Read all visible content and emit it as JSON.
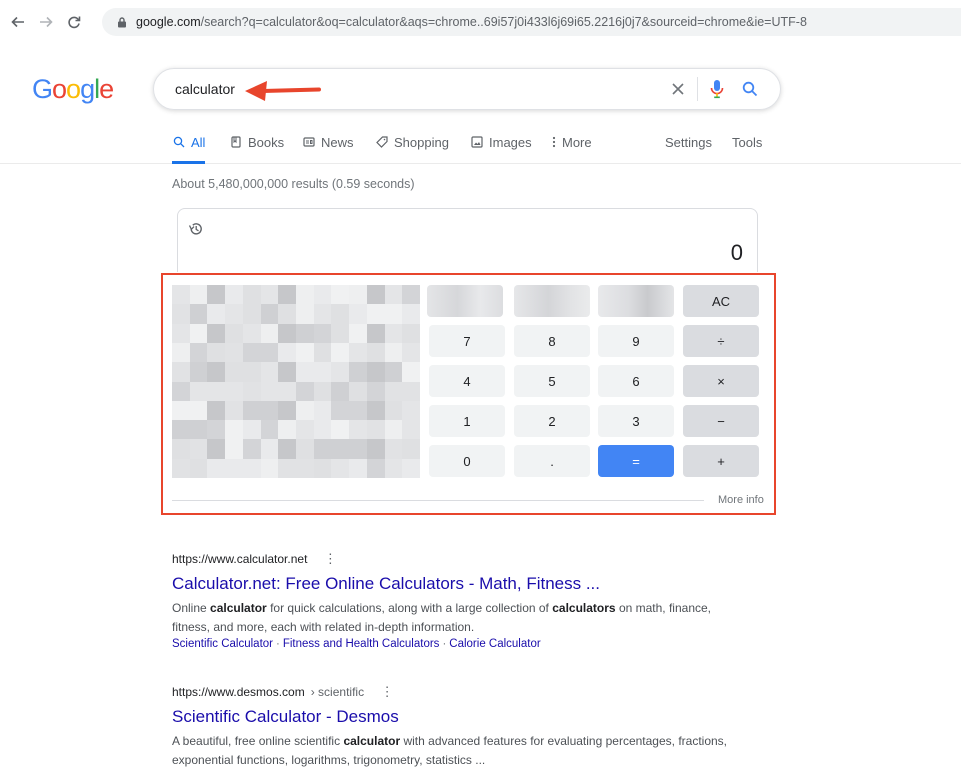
{
  "browser": {
    "url_host": "google.com",
    "url_rest": "/search?q=calculator&oq=calculator&aqs=chrome..69i57j0i433l6j69i65.2216j0j7&sourceid=chrome&ie=UTF-8"
  },
  "logo": {
    "letters": [
      "G",
      "o",
      "o",
      "g",
      "l",
      "e"
    ],
    "colors": [
      "#4285f4",
      "#ea4335",
      "#fbbc05",
      "#4285f4",
      "#34a853",
      "#ea4335"
    ]
  },
  "search": {
    "query": "calculator"
  },
  "tabs": [
    {
      "label": "All",
      "icon": "search-icon",
      "active": true
    },
    {
      "label": "Books",
      "icon": "book-icon"
    },
    {
      "label": "News",
      "icon": "news-icon"
    },
    {
      "label": "Shopping",
      "icon": "tag-icon"
    },
    {
      "label": "Images",
      "icon": "image-icon"
    },
    {
      "label": "More",
      "icon": "more-vert-icon"
    },
    {
      "label": "Settings"
    },
    {
      "label": "Tools"
    }
  ],
  "stats": "About 5,480,000,000 results (0.59 seconds)",
  "calculator": {
    "display": "0",
    "keys": {
      "ac": "AC",
      "divide": "÷",
      "multiply": "×",
      "minus": "−",
      "plus": "+",
      "equals": "=",
      "decimal": ".",
      "d7": "7",
      "d8": "8",
      "d9": "9",
      "d4": "4",
      "d5": "5",
      "d6": "6",
      "d1": "1",
      "d2": "2",
      "d3": "3",
      "d0": "0"
    },
    "more_info": "More info",
    "colors": {
      "accent": "#4285f4",
      "highlight": "#e8452c"
    }
  },
  "results": [
    {
      "url": "https://www.calculator.net",
      "crumb": "",
      "title": "Calculator.net: Free Online Calculators - Math, Fitness ...",
      "snippet_parts": [
        [
          "Online ",
          false
        ],
        [
          "calculator",
          true
        ],
        [
          " for quick calculations, along with a large collection of ",
          false
        ],
        [
          "calculators",
          true
        ],
        [
          " on math, finance, fitness, and more, each with related in-depth information.",
          false
        ]
      ],
      "links": [
        "Scientific Calculator",
        "Fitness and Health Calculators",
        "Calorie Calculator"
      ]
    },
    {
      "url": "https://www.desmos.com",
      "crumb": "› scientific",
      "title": "Scientific Calculator - Desmos",
      "snippet_parts": [
        [
          "A beautiful, free online scientific ",
          false
        ],
        [
          "calculator",
          true
        ],
        [
          " with advanced features for evaluating percentages, fractions, exponential functions, logarithms, trigonometry, statistics ...",
          false
        ]
      ],
      "links": []
    }
  ]
}
